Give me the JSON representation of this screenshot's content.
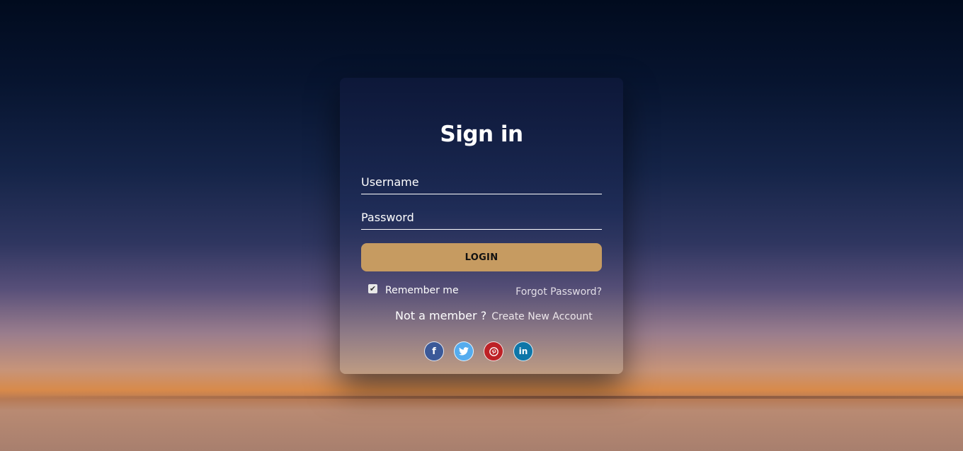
{
  "form": {
    "title": "Sign in",
    "username_placeholder": "Username",
    "password_placeholder": "Password",
    "login_label": "LOGIN",
    "remember_label": "Remember me",
    "remember_checked": true,
    "forgot_label": "Forgot Password?",
    "not_member_label": "Not a member ?",
    "create_account_label": "Create New Account"
  },
  "socials": [
    {
      "name": "facebook-icon",
      "glyph": "f",
      "color": "#3b5998"
    },
    {
      "name": "twitter-icon",
      "glyph": "🐦",
      "color": "#55acee"
    },
    {
      "name": "pinterest-icon",
      "glyph": "P",
      "color": "#bd2126"
    },
    {
      "name": "linkedin-icon",
      "glyph": "in",
      "color": "#0e76a8"
    }
  ],
  "colors": {
    "login_button": "#c69b61",
    "text": "#ffffff"
  }
}
